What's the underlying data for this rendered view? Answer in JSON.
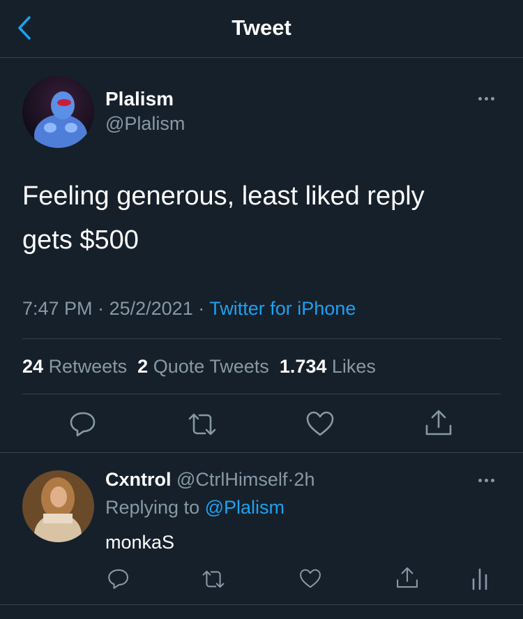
{
  "header": {
    "title": "Tweet"
  },
  "tweet": {
    "author_name": "Plalism",
    "author_handle": "@Plalism",
    "text_line1": "Feeling generous, least liked reply",
    "text_line2": "gets $500",
    "time": "7:47 PM",
    "sep1": "·",
    "date": "25/2/2021",
    "sep2": "·",
    "source": "Twitter for iPhone",
    "retweets_count": "24",
    "retweets_label": "Retweets",
    "quotes_count": "2",
    "quotes_label": "Quote Tweets",
    "likes_count": "1.734",
    "likes_label": "Likes"
  },
  "reply": {
    "author_name": "Cxntrol",
    "author_handle": "@CtrlHimself",
    "sep": "·",
    "time": "2h",
    "replying_prefix": "Replying to",
    "replying_handle": "@Plalism",
    "text": "monkaS"
  },
  "colors": {
    "background": "#15202b",
    "divider": "#38444d",
    "muted": "#8899a6",
    "accent": "#1da1f2"
  },
  "icons": [
    "back-chevron-icon",
    "more-icon",
    "reply-icon",
    "retweet-icon",
    "like-icon",
    "share-icon",
    "analytics-icon"
  ]
}
